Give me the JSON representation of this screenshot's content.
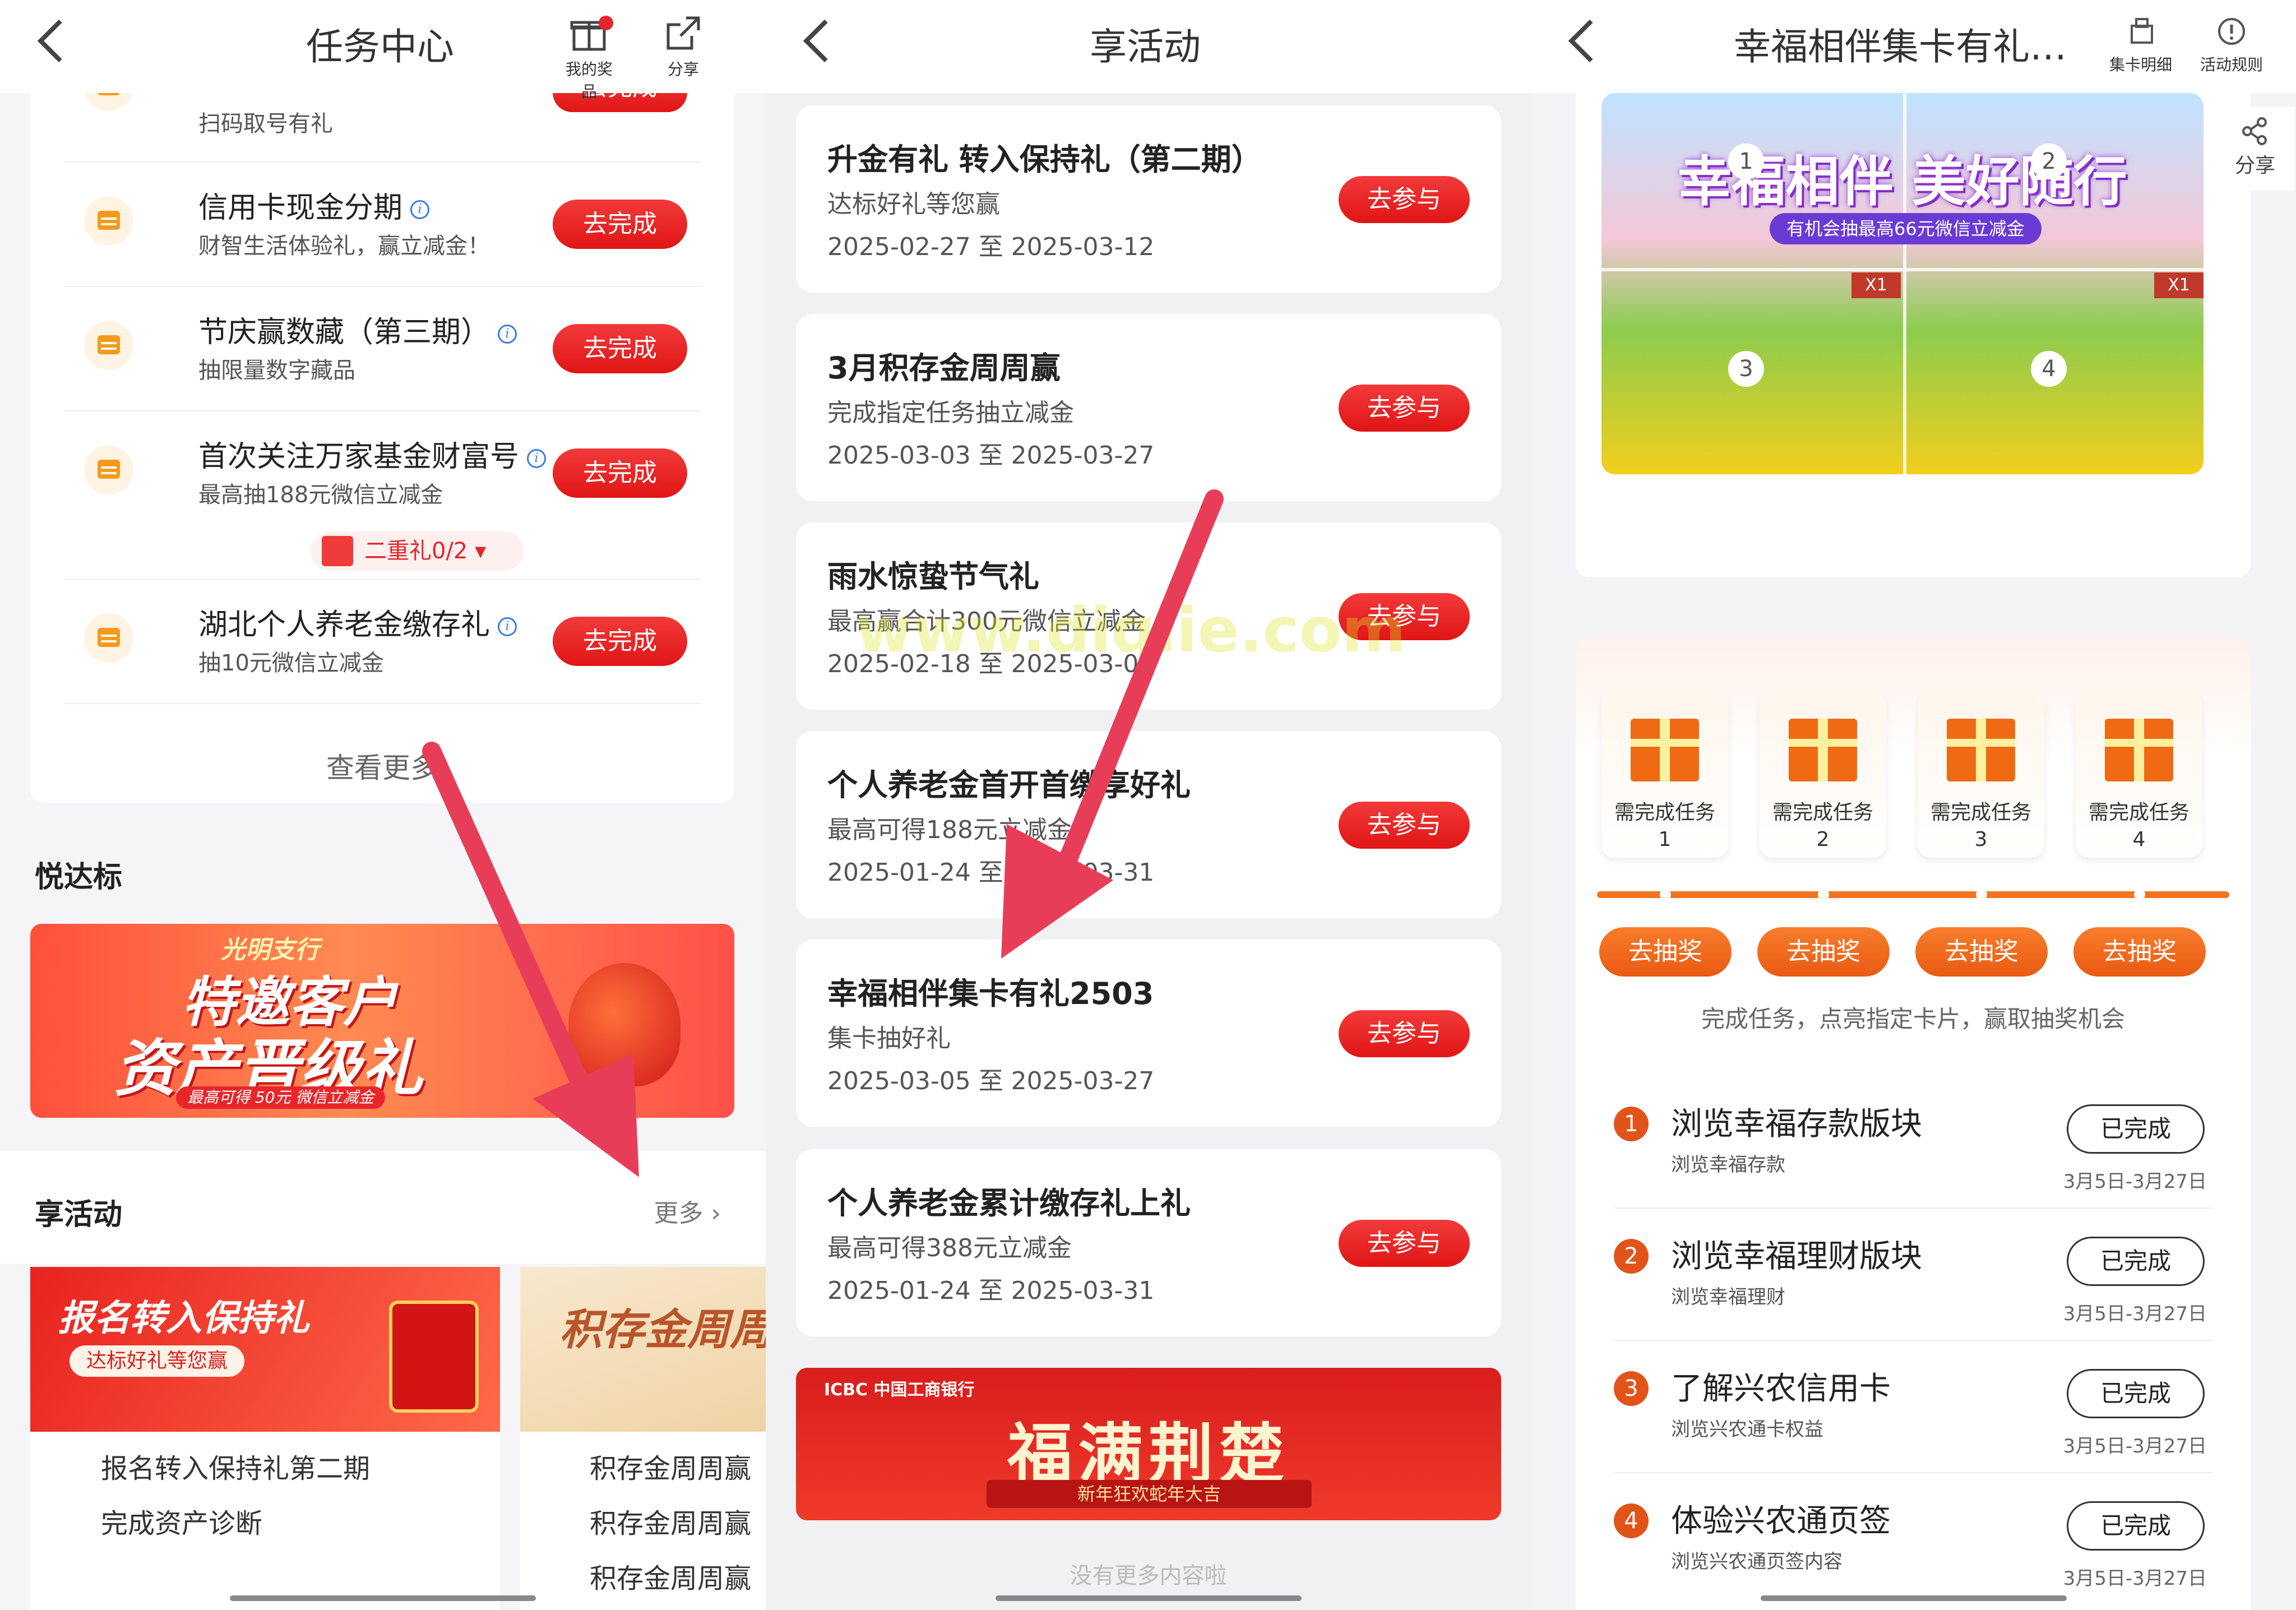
{
  "panel1": {
    "title": "任务中心",
    "header_icons": [
      {
        "label": "我的奖品",
        "icon": "gift-icon"
      },
      {
        "label": "分享",
        "icon": "share-icon"
      }
    ],
    "partial_task": {
      "desc": "扫码取号有礼",
      "button": "去完成"
    },
    "tasks": [
      {
        "name": "信用卡现金分期",
        "desc": "财智生活体验礼，赢立减金！",
        "button": "去完成"
      },
      {
        "name": "节庆赢数藏（第三期）",
        "desc": "抽限量数字藏品",
        "button": "去完成"
      },
      {
        "name": "首次关注万家基金财富号",
        "desc": "最高抽188元微信立减金",
        "button": "去完成"
      },
      {
        "name": "湖北个人养老金缴存礼",
        "desc": "抽10元微信立减金",
        "button": "去完成"
      }
    ],
    "double_gift": "二重礼0/2",
    "see_more": "查看更多",
    "section_yuedabiao": "悦达标",
    "banner1": {
      "top": "光明支行",
      "line1": "特邀客户",
      "line2": "资产晋级礼",
      "sub": "最高可得 50元 微信立减金"
    },
    "section_xiang": "享活动",
    "more": "更多",
    "card_left": {
      "title": "报名转入保持礼",
      "sub": "达标好礼等您赢",
      "items": [
        "报名转入保持礼第二期",
        "完成资产诊断"
      ]
    },
    "card_right": {
      "title": "积存金周周",
      "items": [
        "积存金周周赢",
        "积存金周周赢",
        "积存金周周赢"
      ]
    }
  },
  "panel2": {
    "title": "享活动",
    "activities": [
      {
        "name": "升金有礼 转入保持礼（第二期）",
        "desc": "达标好礼等您赢",
        "date": "2025-02-27 至 2025-03-12",
        "button": "去参与"
      },
      {
        "name": "3月积存金周周赢",
        "desc": "完成指定任务抽立减金",
        "date": "2025-03-03 至 2025-03-27",
        "button": "去参与"
      },
      {
        "name": "雨水惊蛰节气礼",
        "desc": "最高赢合计300元微信立减金",
        "date": "2025-02-18 至 2025-03-05",
        "button": "去参与"
      },
      {
        "name": "个人养老金首开首缴享好礼",
        "desc": "最高可得188元立减金",
        "date": "2025-01-24 至 2025-03-31",
        "button": "去参与"
      },
      {
        "name": "幸福相伴集卡有礼2503",
        "desc": "集卡抽好礼",
        "date": "2025-03-05 至 2025-03-27",
        "button": "去参与"
      },
      {
        "name": "个人养老金累计缴存礼上礼",
        "desc": "最高可得388元立减金",
        "date": "2025-01-24 至 2025-03-31",
        "button": "去参与"
      }
    ],
    "watermark": "www.diqlie.com",
    "banner": {
      "top": "ICBC 中国工商银行",
      "title": "福满荆楚",
      "sub": "新年狂欢蛇年大吉"
    },
    "footer": "没有更多内容啦"
  },
  "panel3": {
    "title": "幸福相伴集卡有礼…",
    "header_icons": [
      {
        "label": "集卡明细",
        "icon": "cards-icon"
      },
      {
        "label": "活动规则",
        "icon": "info-icon"
      }
    ],
    "share": "分享",
    "hero": {
      "title": "幸福相伴 美好随行",
      "sub": "有机会抽最高66元微信立减金",
      "badge": "X1",
      "nums": [
        "1",
        "2",
        "3",
        "4"
      ]
    },
    "gifts": [
      {
        "label": "需完成任务",
        "num": "1"
      },
      {
        "label": "需完成任务",
        "num": "2"
      },
      {
        "label": "需完成任务",
        "num": "3"
      },
      {
        "label": "需完成任务",
        "num": "4"
      }
    ],
    "draw_button": "去抽奖",
    "hint": "完成任务，点亮指定卡片，赢取抽奖机会",
    "tasks": [
      {
        "num": "1",
        "title": "浏览幸福存款版块",
        "desc": "浏览幸福存款",
        "button": "已完成",
        "date": "3月5日-3月27日"
      },
      {
        "num": "2",
        "title": "浏览幸福理财版块",
        "desc": "浏览幸福理财",
        "button": "已完成",
        "date": "3月5日-3月27日"
      },
      {
        "num": "3",
        "title": "了解兴农信用卡",
        "desc": "浏览兴农通卡权益",
        "button": "已完成",
        "date": "3月5日-3月27日"
      },
      {
        "num": "4",
        "title": "体验兴农通页签",
        "desc": "浏览兴农通页签内容",
        "button": "已完成",
        "date": "3月5日-3月27日"
      }
    ]
  }
}
